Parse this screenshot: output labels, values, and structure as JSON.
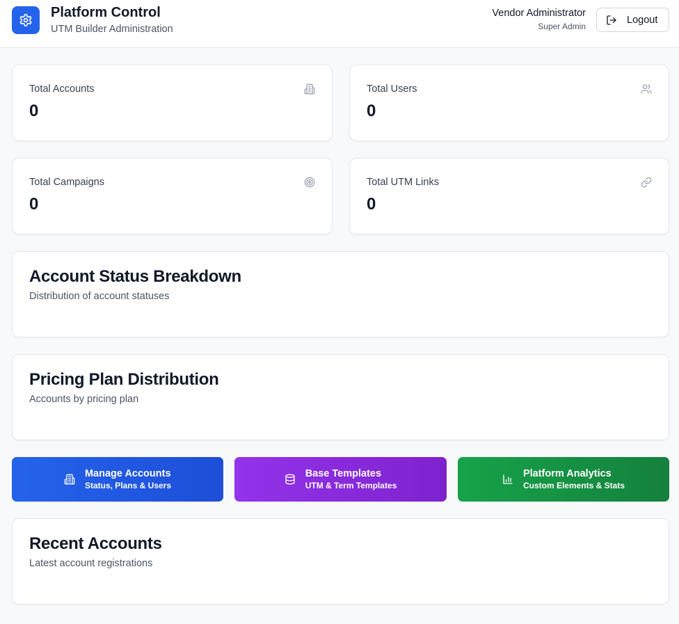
{
  "header": {
    "title": "Platform Control",
    "subtitle": "UTM Builder Administration",
    "logo_icon": "gear-icon",
    "user_name": "Vendor Administrator",
    "user_role": "Super Admin",
    "logout_label": "Logout",
    "logout_icon": "logout-icon"
  },
  "stats": [
    {
      "label": "Total Accounts",
      "value": "0",
      "icon": "building-icon"
    },
    {
      "label": "Total Users",
      "value": "0",
      "icon": "users-icon"
    },
    {
      "label": "Total Campaigns",
      "value": "0",
      "icon": "target-icon"
    },
    {
      "label": "Total UTM Links",
      "value": "0",
      "icon": "link-icon"
    }
  ],
  "sections": {
    "status": {
      "title": "Account Status Breakdown",
      "description": "Distribution of account statuses"
    },
    "pricing": {
      "title": "Pricing Plan Distribution",
      "description": "Accounts by pricing plan"
    },
    "recent": {
      "title": "Recent Accounts",
      "description": "Latest account registrations"
    }
  },
  "actions": [
    {
      "title": "Manage Accounts",
      "subtitle": "Status, Plans & Users",
      "icon": "building-icon",
      "color": "#2563eb"
    },
    {
      "title": "Base Templates",
      "subtitle": "UTM & Term Templates",
      "icon": "database-icon",
      "color": "#9333ea"
    },
    {
      "title": "Platform Analytics",
      "subtitle": "Custom Elements & Stats",
      "icon": "bar-chart-icon",
      "color": "#16a34a"
    }
  ],
  "colors": {
    "accent": "#2563eb",
    "background": "#f8f9fb"
  }
}
